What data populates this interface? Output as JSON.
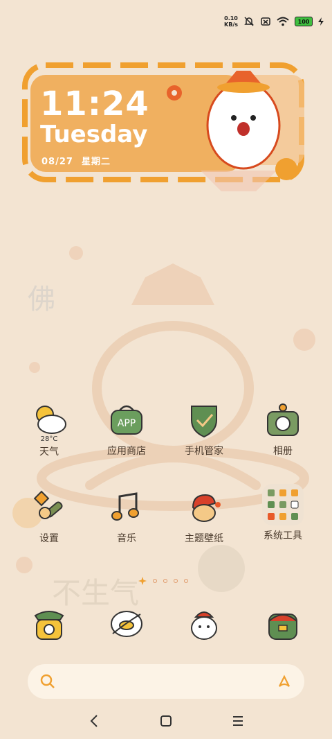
{
  "status_bar": {
    "net_speed_value": "0.10",
    "net_speed_unit": "KB/s",
    "battery": "100",
    "icons": [
      "bell-muted-icon",
      "sim-off-icon",
      "wifi-icon",
      "battery-icon",
      "charging-icon"
    ]
  },
  "clock_widget": {
    "time": "11:24",
    "day": "Tuesday",
    "date": "08/27",
    "weekday_cn": "星期二"
  },
  "apps_row1": [
    {
      "label": "天气",
      "extra": "28°C",
      "icon": "weather-icon"
    },
    {
      "label": "应用商店",
      "icon": "app-store-icon",
      "badge": "APP"
    },
    {
      "label": "手机管家",
      "icon": "security-icon"
    },
    {
      "label": "相册",
      "icon": "gallery-icon"
    }
  ],
  "apps_row2": [
    {
      "label": "设置",
      "icon": "settings-icon"
    },
    {
      "label": "音乐",
      "icon": "music-icon"
    },
    {
      "label": "主题壁纸",
      "icon": "themes-icon"
    },
    {
      "label": "系统工具",
      "icon": "tools-folder-icon"
    }
  ],
  "page_indicator": {
    "pages": 5,
    "current": 1
  },
  "dock": [
    {
      "icon": "phone-icon"
    },
    {
      "icon": "messages-icon"
    },
    {
      "icon": "browser-icon"
    },
    {
      "icon": "wallet-icon"
    }
  ],
  "search_bar": {
    "icons": [
      "search-icon",
      "assistant-icon"
    ]
  },
  "nav_bar": {
    "icons": [
      "back-icon",
      "home-icon",
      "recents-icon"
    ]
  },
  "colors": {
    "background": "#f3e4d2",
    "widget_orange": "#f0a850",
    "accent_red": "#e85a2a",
    "icon_green": "#4f8a5a"
  }
}
